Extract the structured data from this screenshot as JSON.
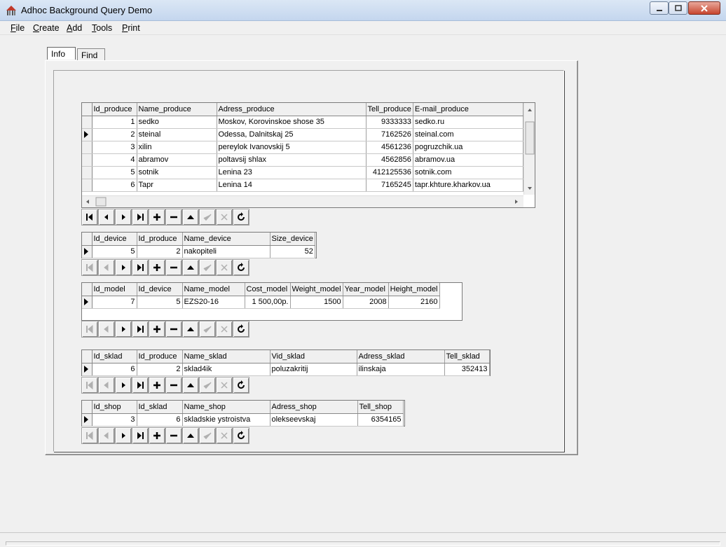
{
  "window": {
    "title": "Adhoc Background Query Demo"
  },
  "menu": {
    "items": [
      {
        "first": "F",
        "rest": "ile"
      },
      {
        "first": "C",
        "rest": "reate"
      },
      {
        "first": "A",
        "rest": "dd"
      },
      {
        "first": "T",
        "rest": "ools"
      },
      {
        "first": "P",
        "rest": "rint"
      }
    ]
  },
  "tabs": [
    "Info",
    "Find"
  ],
  "produce": {
    "headers": [
      "Id_produce",
      "Name_produce",
      "Adress_produce",
      "Tell_produce",
      "E-mail_produce"
    ],
    "rows": [
      [
        "1",
        "sedko",
        "Moskov, Korovinskoe shose 35",
        "9333333",
        "sedko.ru"
      ],
      [
        "2",
        "steinal",
        "Odessa, Dalnitskaj 25",
        "7162526",
        "steinal.com"
      ],
      [
        "3",
        "xilin",
        "pereylok Ivanovskij 5",
        "4561236",
        "pogruzchik.ua"
      ],
      [
        "4",
        "abramov",
        "poltavsij shlax",
        "4562856",
        "abramov.ua"
      ],
      [
        "5",
        "sotnik",
        "Lenina 23",
        "412125536",
        "sotnik.com"
      ],
      [
        "6",
        "Tapr",
        "Lenina 14",
        "7165245",
        "tapr.khture.kharkov.ua"
      ]
    ]
  },
  "device": {
    "headers": [
      "Id_device",
      "Id_produce",
      "Name_device",
      "Size_device"
    ],
    "rows": [
      [
        "5",
        "2",
        "nakopiteli",
        "52"
      ]
    ]
  },
  "model": {
    "headers": [
      "Id_model",
      "Id_device",
      "Name_model",
      "Cost_model",
      "Weight_model",
      "Year_model",
      "Height_model"
    ],
    "rows": [
      [
        "7",
        "5",
        "EZS20-16",
        "1 500,00р.",
        "1500",
        "2008",
        "2160"
      ]
    ]
  },
  "sklad": {
    "headers": [
      "Id_sklad",
      "Id_produce",
      "Name_sklad",
      "Vid_sklad",
      "Adress_sklad",
      "Tell_sklad"
    ],
    "rows": [
      [
        "6",
        "2",
        "sklad4ik",
        "poluzakritij",
        "ilinskaja",
        "352413"
      ]
    ]
  },
  "shop": {
    "headers": [
      "Id_shop",
      "Id_sklad",
      "Name_shop",
      "Adress_shop",
      "Tell_shop"
    ],
    "rows": [
      [
        "3",
        "6",
        "skladskie ystroistva",
        "olekseevskaj",
        "6354165"
      ]
    ]
  },
  "navigator_buttons": [
    "first-icon",
    "prior-icon",
    "next-icon",
    "last-icon",
    "insert-icon",
    "delete-icon",
    "edit-icon",
    "post-icon",
    "cancel-icon",
    "refresh-icon"
  ]
}
